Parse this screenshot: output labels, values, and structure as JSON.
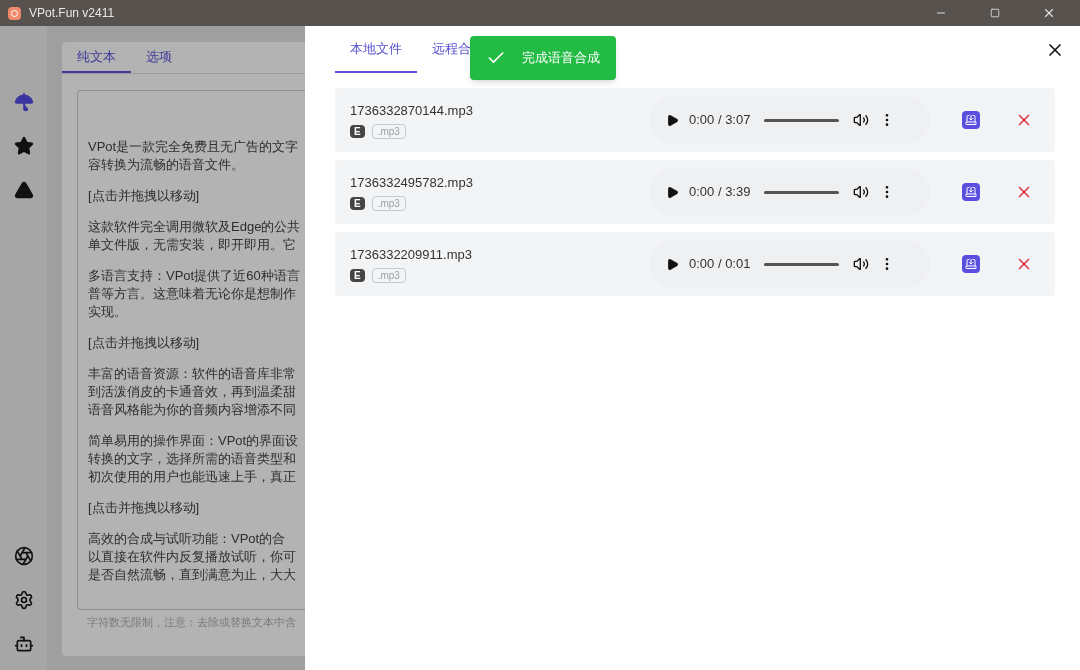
{
  "window": {
    "title": "VPot.Fun v2411"
  },
  "sidebar": {
    "items": [
      {
        "selected": true
      },
      {
        "selected": false
      },
      {
        "selected": false
      }
    ]
  },
  "editor": {
    "tabs": [
      {
        "label": "纯文本",
        "selected": true
      },
      {
        "label": "选项",
        "selected": false
      }
    ],
    "paragraphs": [
      {
        "lines": [
          "VPot是一款完全免费且无广告的文字",
          "容转换为流畅的语音文件。"
        ]
      },
      {
        "lines": [
          "[点击并拖拽以移动]"
        ]
      },
      {
        "lines": [
          "这款软件完全调用微软及Edge的公共",
          "单文件版，无需安装，即开即用。它"
        ]
      },
      {
        "lines": [
          "多语言支持：VPot提供了近60种语言",
          "普等方言。这意味着无论你是想制作",
          "实现。"
        ]
      },
      {
        "lines": [
          "[点击并拖拽以移动]"
        ]
      },
      {
        "lines": [
          "丰富的语音资源：软件的语音库非常",
          "到活泼俏皮的卡通音效，再到温柔甜",
          "语音风格能为你的音频内容增添不同"
        ]
      },
      {
        "lines": [
          "简单易用的操作界面：VPot的界面设",
          "转换的文字，选择所需的语音类型和",
          "初次使用的用户也能迅速上手，真正"
        ]
      },
      {
        "lines": [
          "[点击并拖拽以移动]"
        ]
      },
      {
        "lines": [
          "高效的合成与试听功能：VPot的合",
          "以直接在软件内反复播放试听，你可",
          "是否自然流畅，直到满意为止，大大"
        ]
      }
    ],
    "footer_hint": "字符数无限制，注意：去除或替换文本中含"
  },
  "drawer": {
    "tabs": [
      {
        "label": "本地文件",
        "selected": true
      },
      {
        "label": "远程合",
        "selected": false
      }
    ],
    "toast": {
      "message": "完成语音合成"
    },
    "files": [
      {
        "name": "1736332870144.mp3",
        "badge": "E",
        "ext": ".mp3",
        "time": "0:00 / 3:07"
      },
      {
        "name": "1736332495782.mp3",
        "badge": "E",
        "ext": ".mp3",
        "time": "0:00 / 3:39"
      },
      {
        "name": "1736332209911.mp3",
        "badge": "E",
        "ext": ".mp3",
        "time": "0:00 / 0:01"
      }
    ]
  }
}
